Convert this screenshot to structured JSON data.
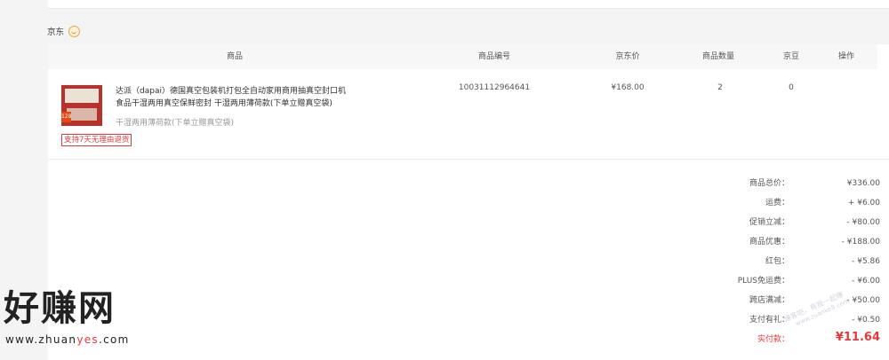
{
  "shop": {
    "name": "京东"
  },
  "table": {
    "headers": [
      "商品",
      "商品编号",
      "京东价",
      "商品数量",
      "京豆",
      "操作"
    ]
  },
  "item": {
    "name_line1": "达派（dapai）德国真空包装机打包全自动家用商用抽真空封口机",
    "name_line2": "食品干湿两用真空保鲜密封 干湿两用薄荷款(下单立赠真空袋)",
    "spec": "干湿两用薄荷款(下单立赠真空袋)",
    "tag": "支持7天无理由退货",
    "sku": "10031112964641",
    "price": "¥168.00",
    "quantity": "2",
    "beans": "0",
    "thumb_badge": "128"
  },
  "summary": [
    {
      "label": "商品总价：",
      "value": "¥336.00"
    },
    {
      "label": "运费：",
      "value": "+ ¥6.00"
    },
    {
      "label": "促销立减：",
      "value": "- ¥80.00"
    },
    {
      "label": "商品优惠：",
      "value": "- ¥188.00"
    },
    {
      "label": "红包：",
      "value": "- ¥5.86"
    },
    {
      "label": "PLUS免运费：",
      "value": "- ¥6.00"
    },
    {
      "label": "跨店满减：",
      "value": "- ¥50.00"
    },
    {
      "label": "支付有礼：",
      "value": "- ¥0.50"
    },
    {
      "label": "实付款：",
      "value": "¥11.64"
    }
  ],
  "watermark": {
    "title": "好赚网",
    "url_prefix": "www.zhuan",
    "url_highlight": "yes",
    "url_suffix": ".com",
    "corner_line1": "赚客吧，有我一起赚",
    "corner_line2": "www.zuanke8.com"
  },
  "colors": {
    "accent": "#e4393c",
    "background": "#f4f4f4"
  }
}
